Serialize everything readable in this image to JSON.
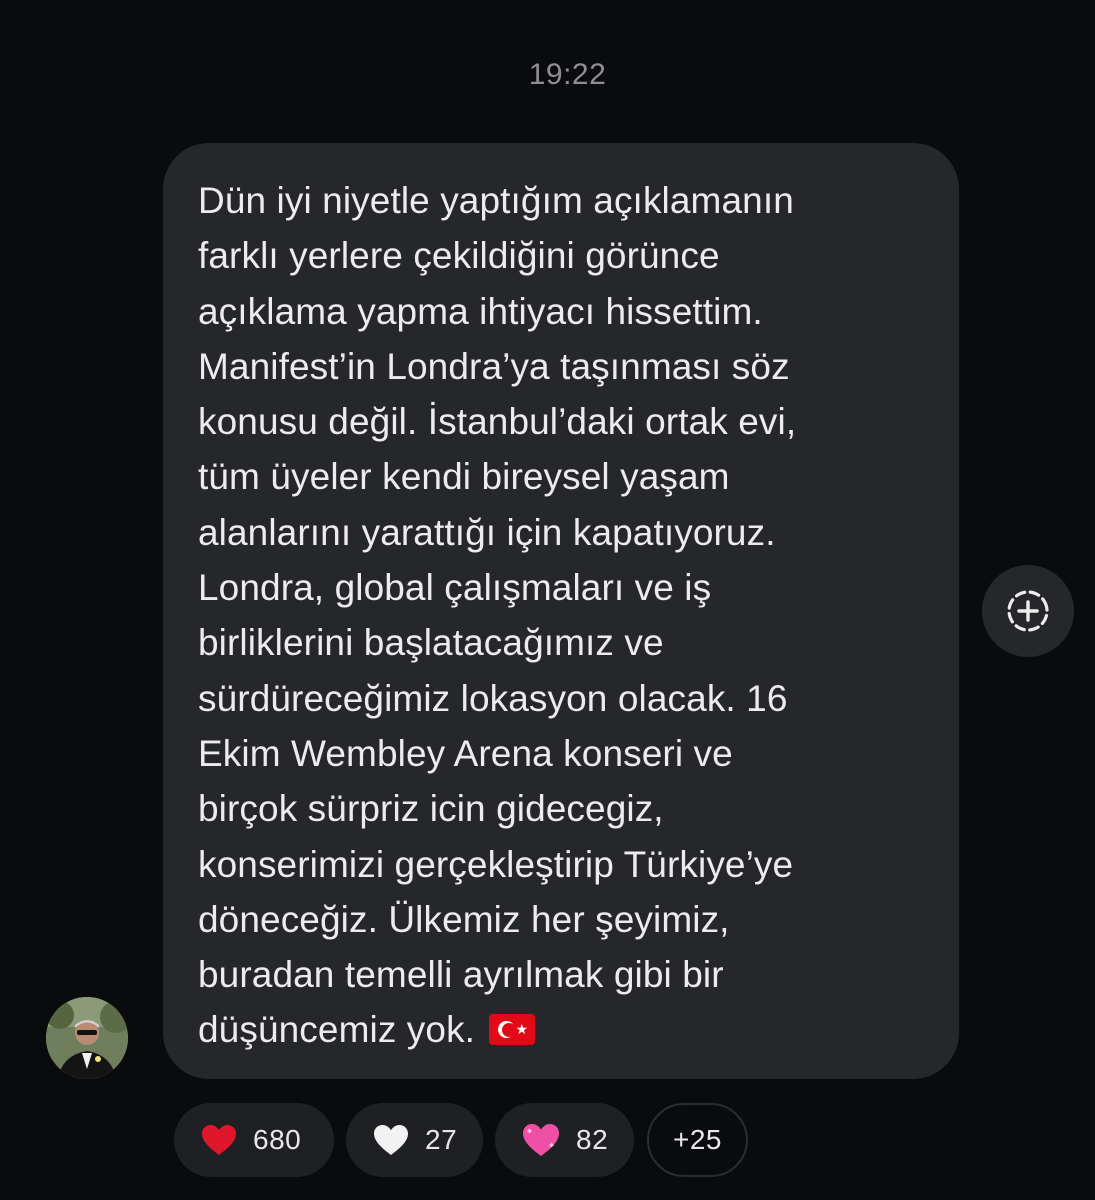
{
  "timestamp": "19:22",
  "message": {
    "text": "Dün iyi niyetle yaptığım açıklamanın\nfarklı yerlere çekildiğini görünce\naçıklama yapma ihtiyacı hissettim.\nManifest’in Londra’ya taşınması söz\nkonusu değil. İstanbul’daki ortak evi,\ntüm üyeler kendi bireysel yaşam\nalanlarını yarattığı için kapatıyoruz.\nLondra, global çalışmaları ve iş\nbirliklerini başlatacağımız ve\nsürdüreceğimiz lokasyon olacak. 16\nEkim Wembley Arena konseri ve\nbirçok sürpriz icin gidecegiz,\nkonserimizi gerçekleştirip Türkiye’ye\ndöneceğiz. Ülkemiz her şeyimiz,\nburadan temelli ayrılmak gibi bir\ndüşüncemiz yok.",
    "emoji_icon": "turkey-flag-icon"
  },
  "react_button_icon": "add-reaction-icon",
  "avatar_icon": "user-avatar",
  "reactions": [
    {
      "icon": "red-heart-icon",
      "color": "#e0172b",
      "count": "680"
    },
    {
      "icon": "white-heart-icon",
      "color": "#f2f2f2",
      "count": "27"
    },
    {
      "icon": "pink-heart-icon",
      "color": "#f04fa6",
      "count": "82"
    }
  ],
  "more_reactions": "+25"
}
